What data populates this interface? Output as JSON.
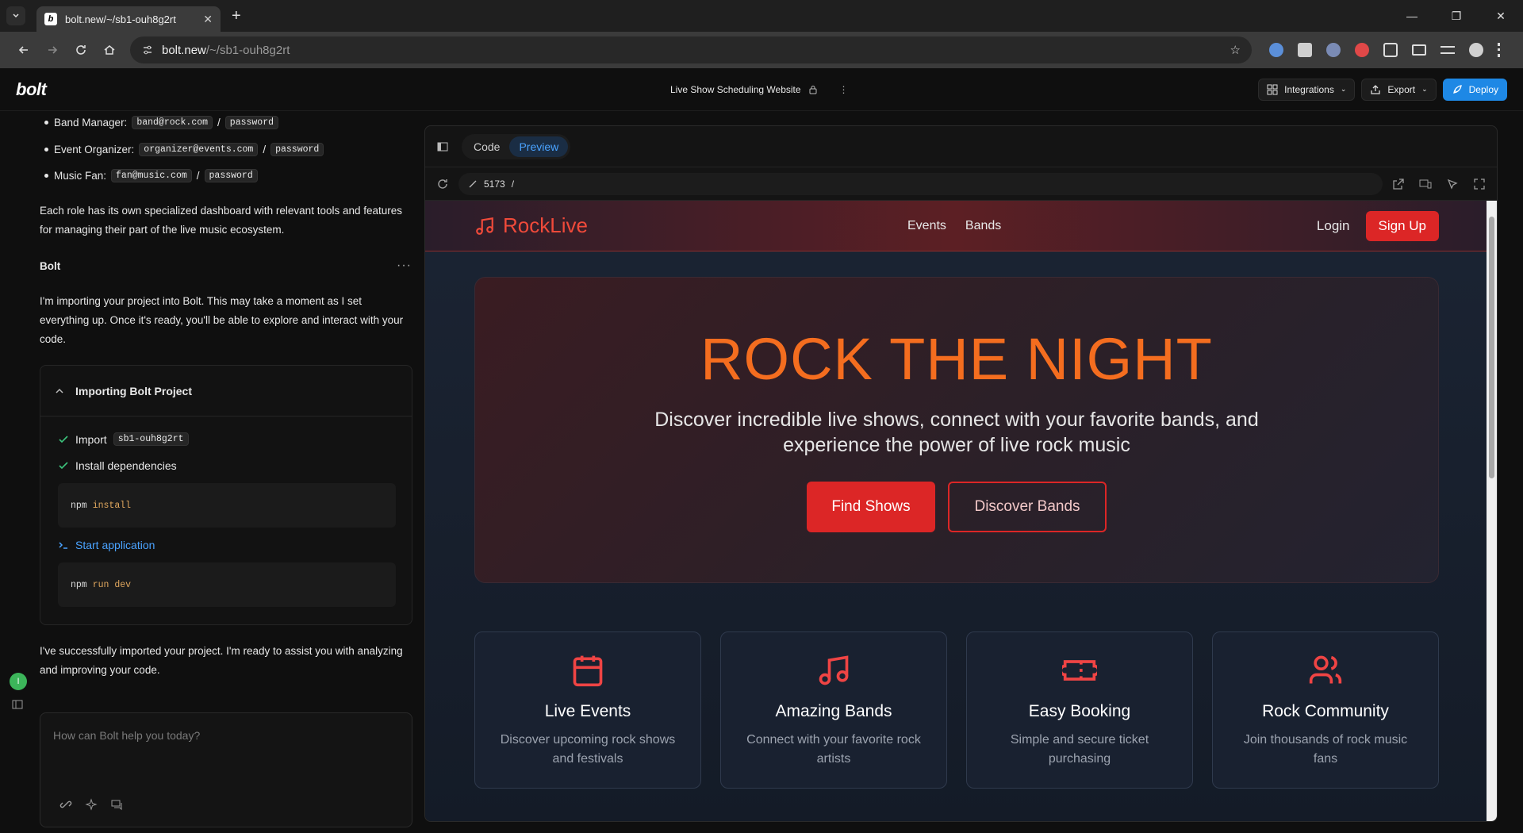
{
  "browser": {
    "tab_title": "bolt.new/~/sb1-ouh8g2rt",
    "url_host": "bolt.new",
    "url_path": "/~/sb1-ouh8g2rt"
  },
  "header": {
    "logo": "bolt",
    "project_title": "Live Show Scheduling Website",
    "integrations": "Integrations",
    "export": "Export",
    "deploy": "Deploy"
  },
  "chat": {
    "credentials": [
      {
        "role": "Band Manager:",
        "email": "band@rock.com",
        "password": "password"
      },
      {
        "role": "Event Organizer:",
        "email": "organizer@events.com",
        "password": "password"
      },
      {
        "role": "Music Fan:",
        "email": "fan@music.com",
        "password": "password"
      }
    ],
    "role_paragraph": "Each role has its own specialized dashboard with relevant tools and features for managing their part of the live music ecosystem.",
    "bolt_label": "Bolt",
    "importing_paragraph": "I'm importing your project into Bolt. This may take a moment as I set everything up. Once it's ready, you'll be able to explore and interact with your code.",
    "import_box_title": "Importing Bolt Project",
    "step_import": "Import",
    "step_import_code": "sb1-ouh8g2rt",
    "step_install": "Install dependencies",
    "cmd_install": {
      "bin": "npm",
      "arg": "install"
    },
    "step_start": "Start application",
    "cmd_start": {
      "bin": "npm",
      "arg": "run dev"
    },
    "done_paragraph": "I've successfully imported your project. I'm ready to assist you with analyzing and improving your code.",
    "input_placeholder": "How can Bolt help you today?",
    "avatar_letter": "I"
  },
  "preview": {
    "tab_code": "Code",
    "tab_preview": "Preview",
    "port": "5173",
    "path": "/"
  },
  "site": {
    "brand": "RockLive",
    "nav_links": [
      "Events",
      "Bands"
    ],
    "login": "Login",
    "signup": "Sign Up",
    "hero_title": "ROCK THE NIGHT",
    "hero_subtitle": "Discover incredible live shows, connect with your favorite bands, and experience the power of live rock music",
    "btn_find": "Find Shows",
    "btn_discover": "Discover Bands",
    "features": [
      {
        "icon": "calendar-icon",
        "title": "Live Events",
        "text": "Discover upcoming rock shows and festivals"
      },
      {
        "icon": "music-note-icon",
        "title": "Amazing Bands",
        "text": "Connect with your favorite rock artists"
      },
      {
        "icon": "ticket-icon",
        "title": "Easy Booking",
        "text": "Simple and secure ticket purchasing"
      },
      {
        "icon": "users-icon",
        "title": "Rock Community",
        "text": "Join thousands of rock music fans"
      }
    ]
  },
  "colors": {
    "accent_red": "#dc2626",
    "hero_orange": "#f46d1f",
    "preview_active": "#4aa3ff",
    "deploy_blue": "#1e88e5"
  }
}
